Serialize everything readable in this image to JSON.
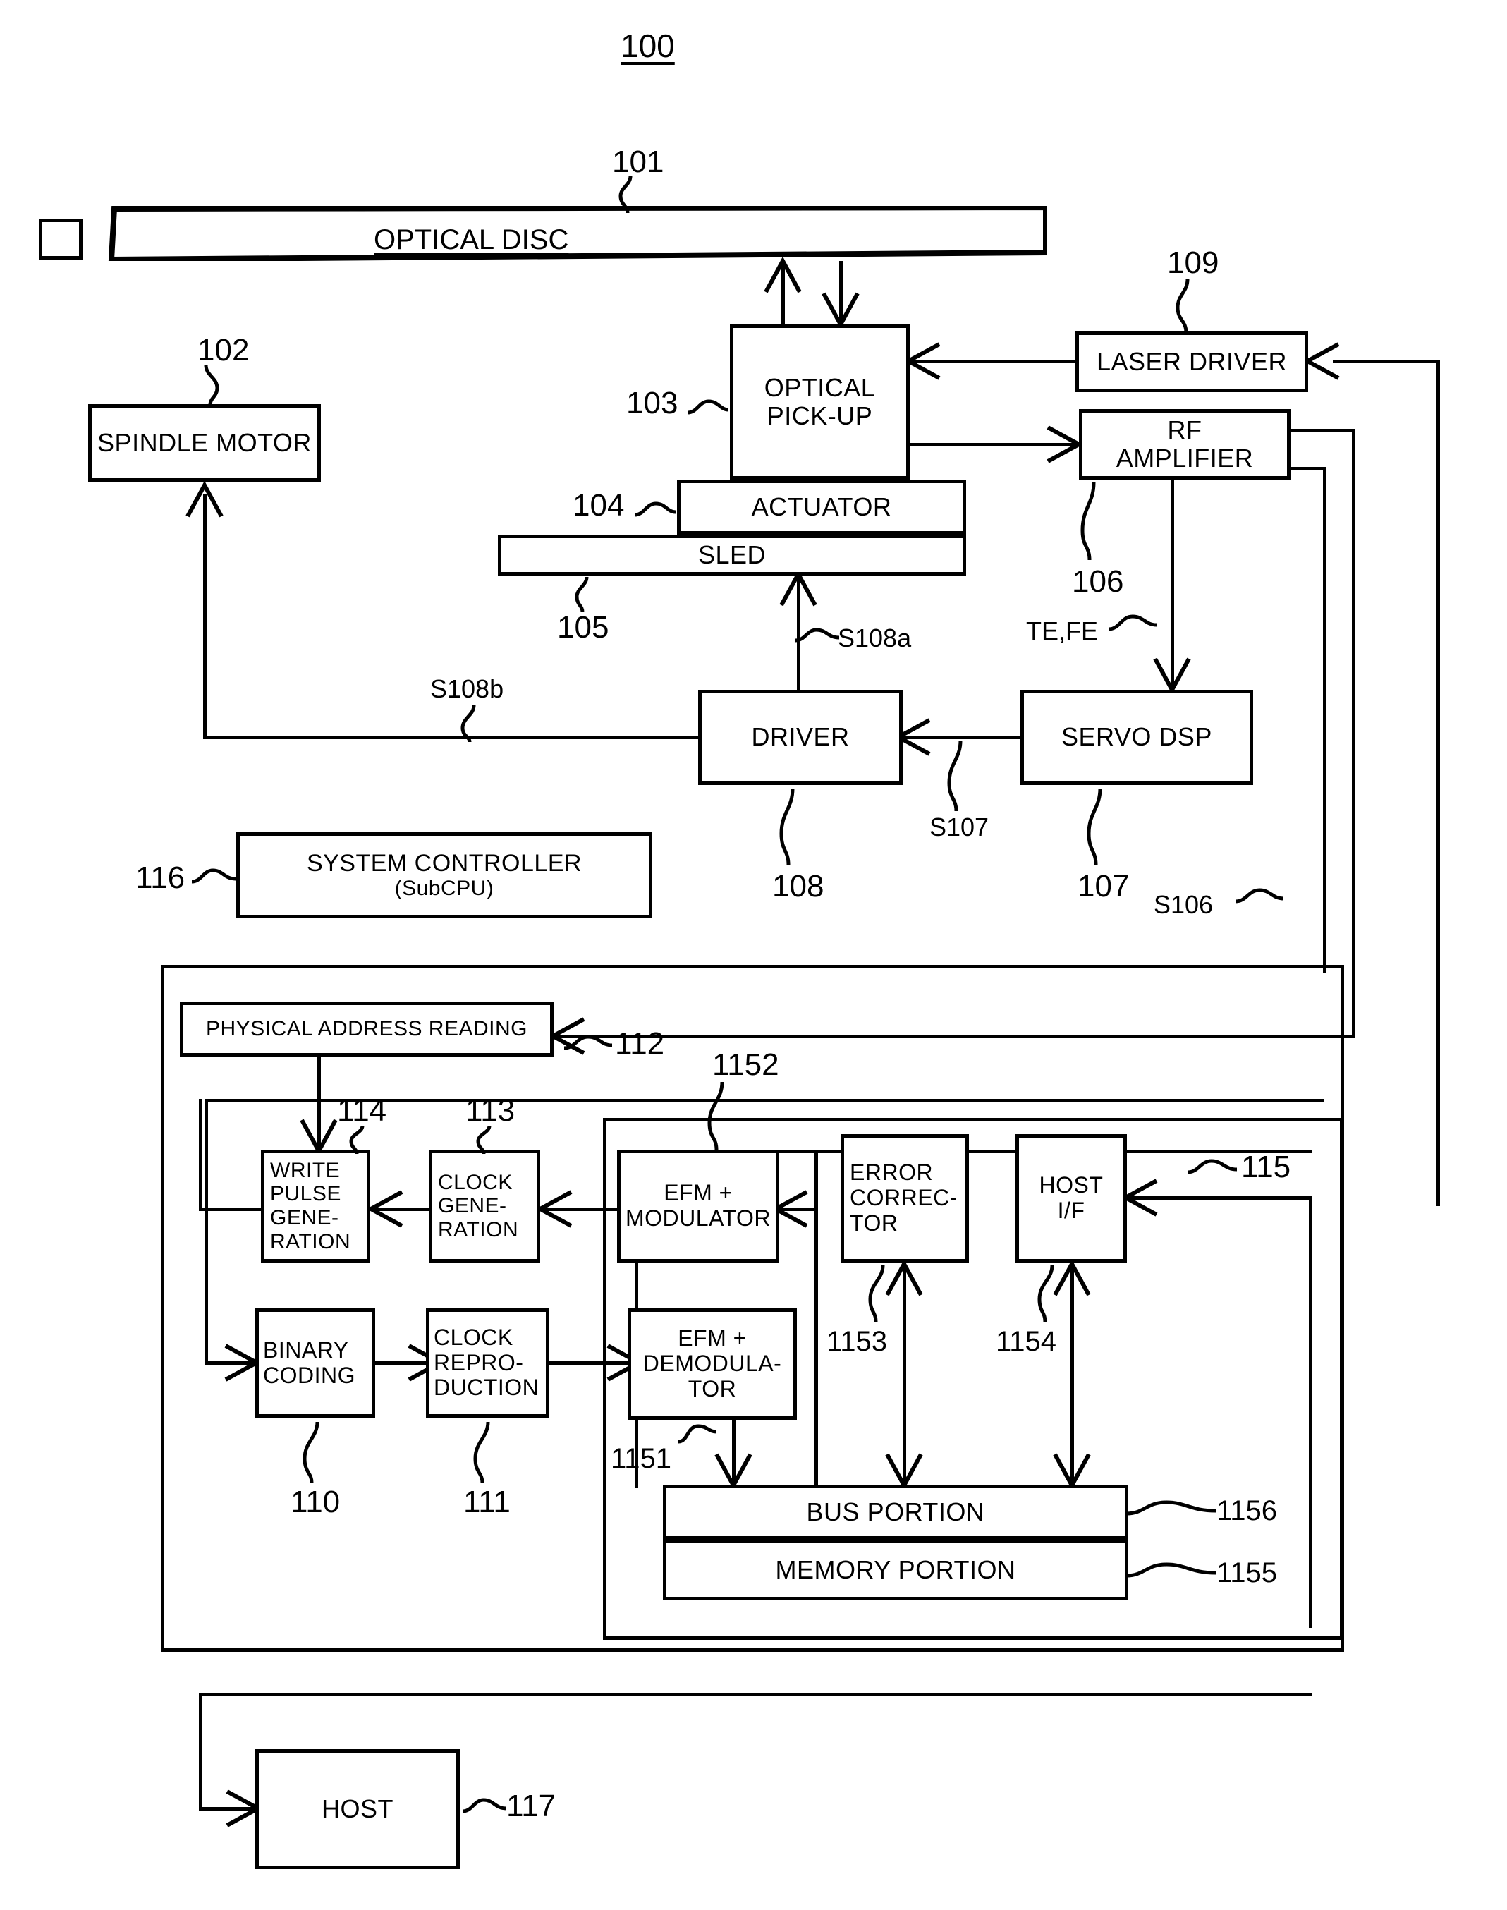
{
  "figure": {
    "number": "100",
    "type": "optical disc drive block diagram"
  },
  "blocks": {
    "optical_disc": "OPTICAL DISC",
    "spindle_motor": "SPINDLE MOTOR",
    "optical_pickup_l1": "OPTICAL",
    "optical_pickup_l2": "PICK-UP",
    "actuator": "ACTUATOR",
    "sled": "SLED",
    "laser_driver": "LASER DRIVER",
    "rf_amplifier_l1": "RF",
    "rf_amplifier_l2": "AMPLIFIER",
    "servo_dsp": "SERVO DSP",
    "driver": "DRIVER",
    "system_controller_l1": "SYSTEM CONTROLLER",
    "system_controller_l2": "(SubCPU)",
    "physical_address_reading": "PHYSICAL ADDRESS READING",
    "write_pulse_generation_l1": "WRITE",
    "write_pulse_generation_l2": "PULSE",
    "write_pulse_generation_l3": "GENE-",
    "write_pulse_generation_l4": "RATION",
    "clock_generation_l1": "CLOCK",
    "clock_generation_l2": "GENE-",
    "clock_generation_l3": "RATION",
    "efm_modulator_l1": "EFM +",
    "efm_modulator_l2": "MODULATOR",
    "error_corrector_l1": "ERROR",
    "error_corrector_l2": "CORREC-",
    "error_corrector_l3": "TOR",
    "host_if_l1": "HOST",
    "host_if_l2": "I/F",
    "binary_coding_l1": "BINARY",
    "binary_coding_l2": "CODING",
    "clock_reproduction_l1": "CLOCK",
    "clock_reproduction_l2": "REPRO-",
    "clock_reproduction_l3": "DUCTION",
    "efm_demodulator_l1": "EFM +",
    "efm_demodulator_l2": "DEMODULA-",
    "efm_demodulator_l3": "TOR",
    "bus_portion": "BUS PORTION",
    "memory_portion": "MEMORY PORTION",
    "host": "HOST"
  },
  "reference_numerals": {
    "n100": "100",
    "n101": "101",
    "n102": "102",
    "n103": "103",
    "n104": "104",
    "n105": "105",
    "n106": "106",
    "n107_signal": "107",
    "n107_block": "107",
    "n108": "108",
    "n109": "109",
    "n110": "110",
    "n111": "111",
    "n112": "112",
    "n113": "113",
    "n114": "114",
    "n115": "115",
    "n116": "116",
    "n117": "117",
    "n1151": "1151",
    "n1152": "1152",
    "n1153": "1153",
    "n1154": "1154",
    "n1155": "1155",
    "n1156": "1156"
  },
  "signal_labels": {
    "s106": "S106",
    "s107": "S107",
    "s108a": "S108a",
    "s108b": "S108b",
    "te_fe": "TE,FE"
  },
  "colors": {
    "ink": "#000000",
    "paper": "#ffffff"
  }
}
